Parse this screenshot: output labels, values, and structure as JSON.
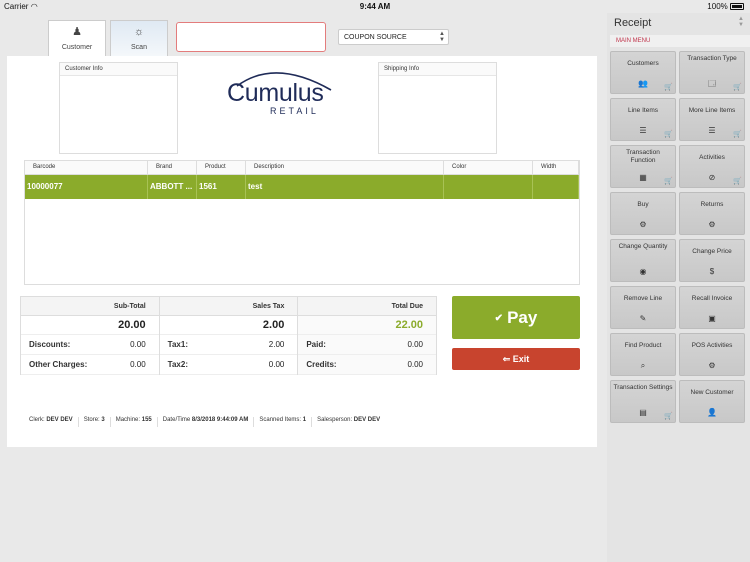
{
  "status_bar": {
    "carrier": "Carrier",
    "time": "9:44 AM",
    "battery": "100%"
  },
  "tabs": [
    {
      "label": "Customer",
      "icon": "person-icon"
    },
    {
      "label": "Scan",
      "icon": "sun-icon"
    }
  ],
  "scan_input": {
    "value": "",
    "placeholder": ""
  },
  "coupon_source": {
    "selected": "COUPON SOURCE"
  },
  "customer_info": {
    "header": "Customer Info"
  },
  "shipping_info": {
    "header": "Shipping Info"
  },
  "logo": {
    "word": "Cumulus",
    "sub": "RETAIL"
  },
  "grid": {
    "columns": [
      "Barcode",
      "Brand",
      "Product",
      "Description",
      "Color",
      "Width"
    ],
    "rows": [
      {
        "barcode": "10000077",
        "brand": "ABBOTT ...",
        "product": "1561",
        "description": "test",
        "color": "",
        "width": ""
      }
    ]
  },
  "totals": {
    "subtotal": {
      "label": "Sub-Total",
      "value": "20.00"
    },
    "sales_tax": {
      "label": "Sales Tax",
      "value": "2.00"
    },
    "total_due": {
      "label": "Total Due",
      "value": "22.00"
    },
    "discounts": {
      "label": "Discounts:",
      "value": "0.00"
    },
    "tax1": {
      "label": "Tax1:",
      "value": "2.00"
    },
    "paid": {
      "label": "Paid:",
      "value": "0.00"
    },
    "other_charges": {
      "label": "Other Charges:",
      "value": "0.00"
    },
    "tax2": {
      "label": "Tax2:",
      "value": "0.00"
    },
    "credits": {
      "label": "Credits:",
      "value": "0.00"
    }
  },
  "actions": {
    "pay": "Pay",
    "exit": "Exit"
  },
  "footer": {
    "clerk_label": "Clerk:",
    "clerk": "DEV DEV",
    "store_label": "Store:",
    "store": "3",
    "machine_label": "Machine:",
    "machine": "155",
    "datetime_label": "Date/Time",
    "datetime": "8/3/2018 9:44:09 AM",
    "scanned_label": "Scanned Items:",
    "scanned": "1",
    "salesperson_label": "Salesperson:",
    "salesperson": "DEV DEV"
  },
  "sidebar": {
    "title": "Receipt",
    "section": "MAIN MENU",
    "items": [
      {
        "label": "Customers",
        "icon": "customers-icon"
      },
      {
        "label": "Transaction Type",
        "icon": "transaction-type-icon"
      },
      {
        "label": "Line Items",
        "icon": "list-icon"
      },
      {
        "label": "More Line Items",
        "icon": "list-icon"
      },
      {
        "label": "Transaction Function",
        "icon": "calculator-icon"
      },
      {
        "label": "Activities",
        "icon": "activities-icon"
      },
      {
        "label": "Buy",
        "icon": "buy-icon"
      },
      {
        "label": "Returns",
        "icon": "returns-icon"
      },
      {
        "label": "Change Quantity",
        "icon": "quantity-icon"
      },
      {
        "label": "Change Price",
        "icon": "price-icon"
      },
      {
        "label": "Remove Line",
        "icon": "remove-icon"
      },
      {
        "label": "Recall Invoice",
        "icon": "recall-icon"
      },
      {
        "label": "Find Product",
        "icon": "find-icon"
      },
      {
        "label": "POS Activities",
        "icon": "pos-activities-icon"
      },
      {
        "label": "Transaction Settings",
        "icon": "settings-icon"
      },
      {
        "label": "New Customer",
        "icon": "new-customer-icon"
      }
    ]
  }
}
